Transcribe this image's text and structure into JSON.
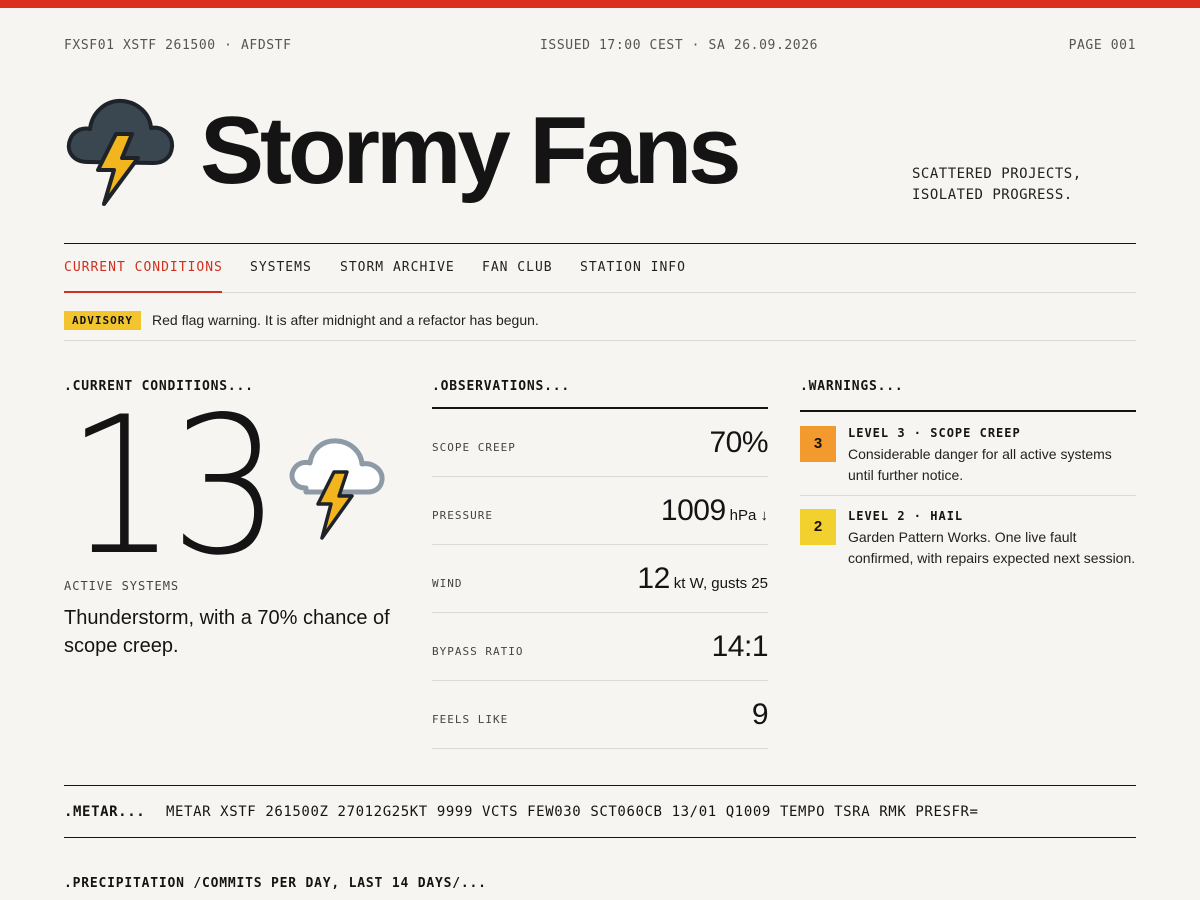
{
  "colors": {
    "accent": "#dc2f1f",
    "background": "#f6f5f2",
    "ink": "#141414",
    "advisory_yellow": "#f2c52e",
    "level3_orange": "#f29a2e",
    "level2_yellow": "#f2d02e",
    "storm_cloud_dark": "#3a4650",
    "storm_cloud_light": "#8e9aa6",
    "bolt": "#f2b51e"
  },
  "header": {
    "code": "FXSF01 XSTF 261500 · AFDSTF",
    "issued": "ISSUED 17:00 CEST · SA 26.09.2026",
    "page": "PAGE 001"
  },
  "brand": {
    "logo_icon": "storm-cloud-lightning-icon",
    "name": "Stormy Fans",
    "tagline_line1": "SCATTERED PROJECTS,",
    "tagline_line2": "ISOLATED PROGRESS."
  },
  "nav": {
    "items": [
      {
        "label": "CURRENT CONDITIONS",
        "active": true
      },
      {
        "label": "SYSTEMS",
        "active": false
      },
      {
        "label": "STORM ARCHIVE",
        "active": false
      },
      {
        "label": "FAN CLUB",
        "active": false
      },
      {
        "label": "STATION INFO",
        "active": false
      }
    ]
  },
  "advisory": {
    "badge": "ADVISORY",
    "text": "Red flag warning. It is after midnight and a refactor has begun."
  },
  "current": {
    "heading": ".CURRENT CONDITIONS...",
    "temperature": "13",
    "icon": "thunderstorm-icon",
    "active_label": "ACTIVE SYSTEMS",
    "summary": "Thunderstorm, with a 70% chance of scope creep."
  },
  "observations": {
    "heading": ".OBSERVATIONS...",
    "rows": [
      {
        "label": "SCOPE CREEP",
        "value": "70%",
        "unit": ""
      },
      {
        "label": "PRESSURE",
        "value": "1009",
        "unit": "hPa ↓"
      },
      {
        "label": "WIND",
        "value": "12",
        "unit": "kt W, gusts 25"
      },
      {
        "label": "BYPASS RATIO",
        "value": "14:1",
        "unit": ""
      },
      {
        "label": "FEELS LIKE",
        "value": "9",
        "unit": ""
      }
    ]
  },
  "warnings": {
    "heading": ".WARNINGS...",
    "items": [
      {
        "level": "3",
        "title": "LEVEL 3 · SCOPE CREEP",
        "description": "Considerable danger for all active systems until further notice."
      },
      {
        "level": "2",
        "title": "LEVEL 2 · HAIL",
        "description": "Garden Pattern Works. One live fault confirmed, with repairs expected next session."
      }
    ]
  },
  "metar": {
    "label": ".METAR...",
    "text": "METAR XSTF 261500Z 27012G25KT 9999 VCTS FEW030 SCT060CB 13/01 Q1009 TEMPO TSRA RMK PRESFR="
  },
  "precipitation": {
    "heading": ".PRECIPITATION /COMMITS PER DAY, LAST 14 DAYS/..."
  }
}
